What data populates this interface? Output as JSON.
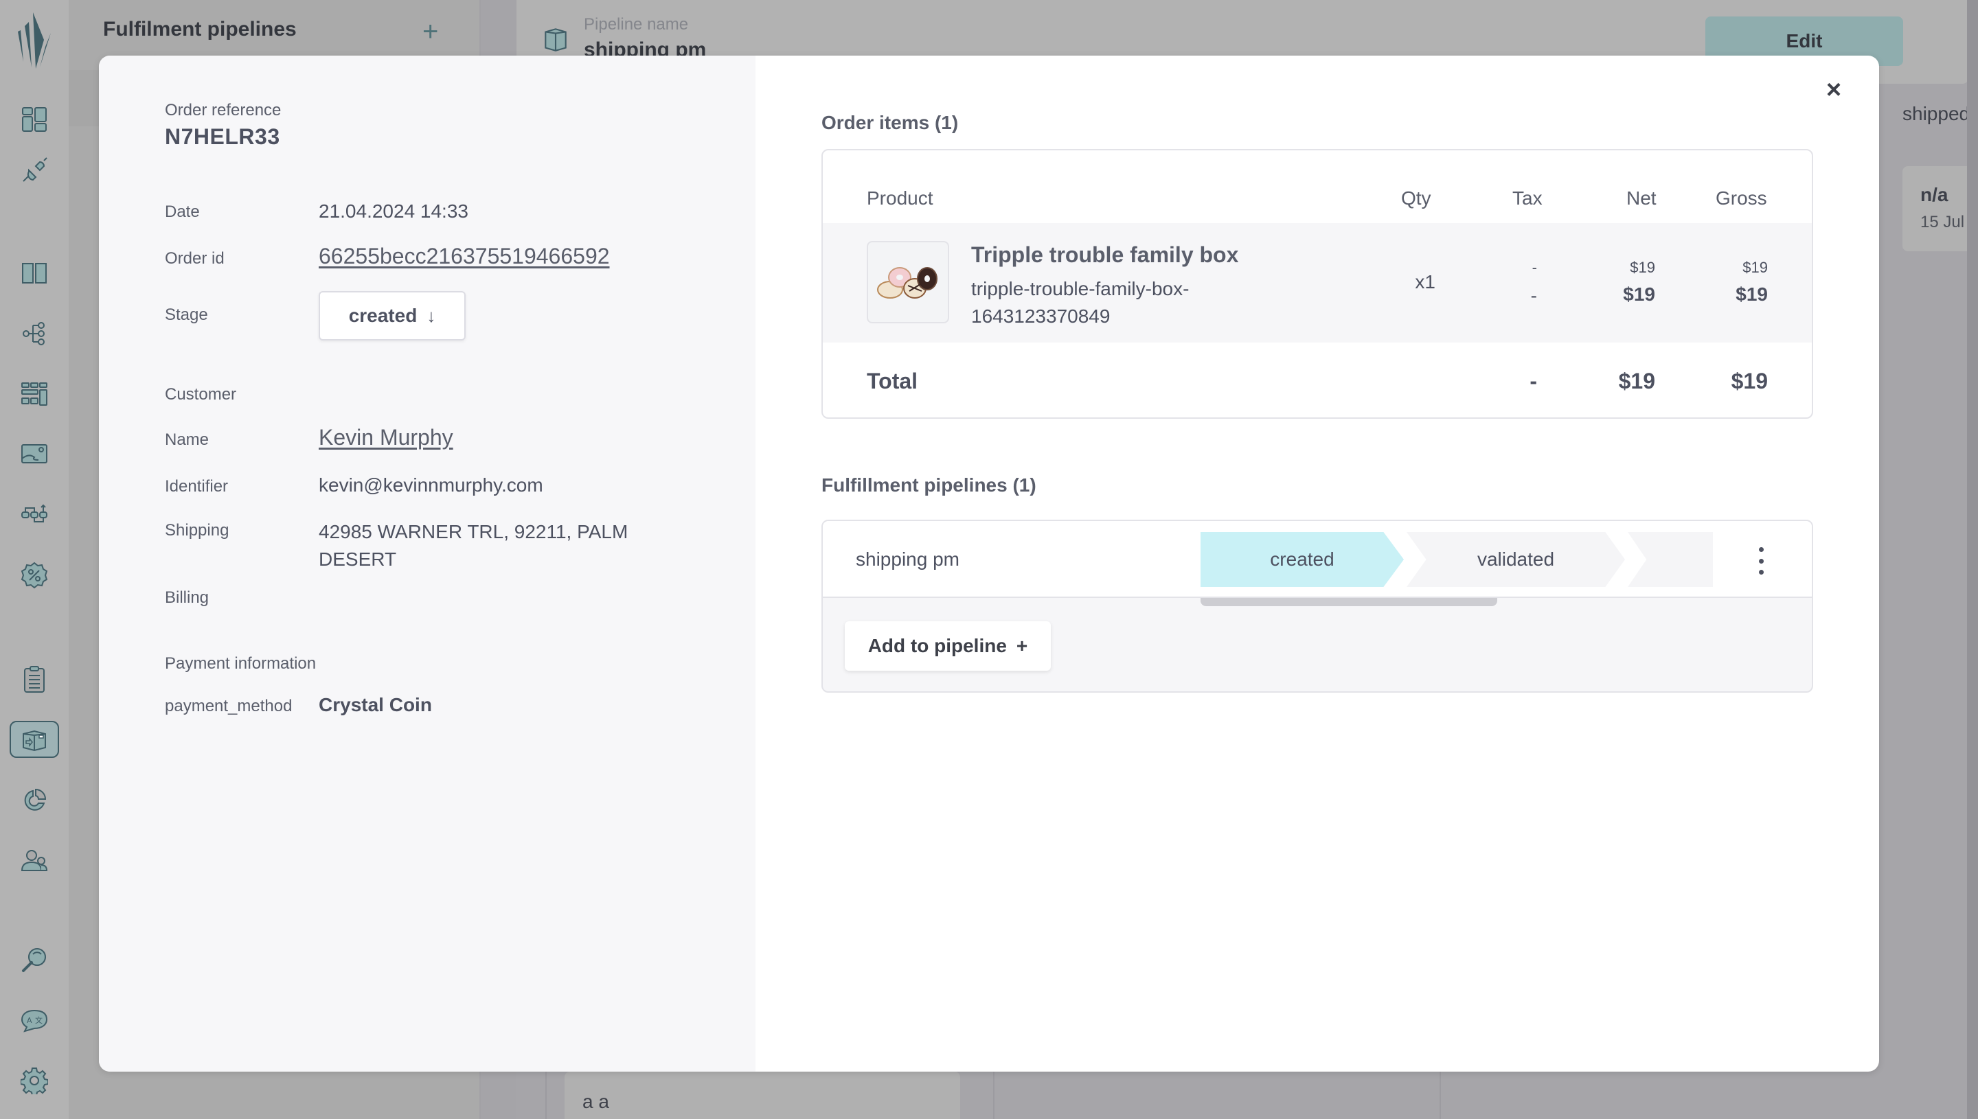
{
  "background": {
    "panel_title": "Fulfilment pipelines",
    "add_icon": "plus-icon",
    "pipeline_label": "Pipeline name",
    "pipeline_name": "shipping pm",
    "edit_label": "Edit",
    "column_title": "shipped",
    "card": {
      "title": "n/a",
      "date": "15 Jul"
    },
    "tile_text": "a a"
  },
  "rail": {
    "items": [
      {
        "icon": "dashboard-icon"
      },
      {
        "icon": "plug-icon"
      },
      {
        "icon": "book-icon"
      },
      {
        "icon": "hierarchy-icon"
      },
      {
        "icon": "grid-icon"
      },
      {
        "icon": "image-icon"
      },
      {
        "icon": "flow-icon"
      },
      {
        "icon": "discount-icon"
      },
      {
        "icon": "clipboard-icon"
      },
      {
        "icon": "box-icon",
        "active": true
      },
      {
        "icon": "chart-icon"
      },
      {
        "icon": "users-icon"
      },
      {
        "icon": "search-icon"
      },
      {
        "icon": "translate-icon"
      },
      {
        "icon": "gear-icon"
      }
    ]
  },
  "order": {
    "reference_label": "Order reference",
    "reference": "N7HELR33",
    "date_label": "Date",
    "date": "21.04.2024 14:33",
    "id_label": "Order id",
    "id": "66255becc216375519466592",
    "stage_label": "Stage",
    "stage": "created",
    "stage_icon": "arrow-down-icon",
    "customer_label": "Customer",
    "name_label": "Name",
    "name": "Kevin Murphy",
    "identifier_label": "Identifier",
    "identifier": "kevin@kevinnmurphy.com",
    "shipping_label": "Shipping",
    "shipping": "42985 WARNER TRL, 92211, PALM DESERT",
    "billing_label": "Billing",
    "billing": "",
    "payment_label": "Payment information",
    "payment_method_label": "payment_method",
    "payment_method": "Crystal Coin"
  },
  "items": {
    "title": "Order items (1)",
    "columns": [
      "Product",
      "Qty",
      "Tax",
      "Net",
      "Gross"
    ],
    "rows": [
      {
        "name": "Tripple trouble family box",
        "sku": "tripple-trouble-family-box-1643123370849",
        "qty": "x1",
        "tax_unit": "-",
        "tax_total": "-",
        "net_unit": "$19",
        "net_total": "$19",
        "gross_unit": "$19",
        "gross_total": "$19"
      }
    ],
    "total_label": "Total",
    "total_tax": "-",
    "total_net": "$19",
    "total_gross": "$19"
  },
  "pipelines": {
    "title": "Fulfillment pipelines (1)",
    "rows": [
      {
        "name": "shipping pm",
        "stages": [
          "created",
          "validated",
          ""
        ],
        "current": "created"
      }
    ],
    "add_label": "Add to pipeline",
    "add_icon": "+"
  },
  "modal": {
    "close_icon": "×"
  },
  "colors": {
    "accent": "#c9f1f6",
    "rail_icon": "#3f5d66",
    "edit_button": "#8fadae"
  }
}
